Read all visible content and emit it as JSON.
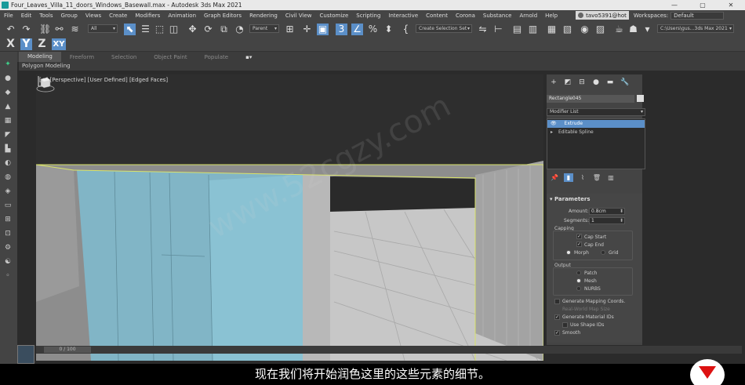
{
  "window": {
    "title": "Four_Leaves_Villa_11_doors_Windows_Basewall.max - Autodesk 3ds Max 2021",
    "min_glyph": "—",
    "max_glyph": "▢",
    "close_glyph": "✕"
  },
  "menubar": {
    "items": [
      "File",
      "Edit",
      "Tools",
      "Group",
      "Views",
      "Create",
      "Modifiers",
      "Animation",
      "Graph Editors",
      "Rendering",
      "Civil View",
      "Customize",
      "Scripting",
      "Interactive",
      "Content",
      "Corona",
      "Substance",
      "Arnold",
      "Help"
    ],
    "user": "tavo5391@hot",
    "workspaces_label": "Workspaces:",
    "workspace": "Default"
  },
  "toolbar": {
    "selection_filter": "All",
    "ref_coord": "Parent",
    "named_selection": "Create Selection Set",
    "path": "C:\\Users\\gus...3ds Max 2021",
    "axis_x": "X",
    "axis_y": "Y",
    "axis_z": "Z",
    "axis_xy": "XY"
  },
  "ribbon": {
    "tabs": [
      "Modeling",
      "Freeform",
      "Selection",
      "Object Paint",
      "Populate"
    ],
    "active_tab": "Modeling",
    "subpanel": "Polygon Modeling"
  },
  "viewport": {
    "label": "[+] [Perspective] [User Defined] [Edged Faces]",
    "selection_color": "#d9e36a",
    "glass_color": "#7fbcd0"
  },
  "command_panel": {
    "object_name": "Rectangle045",
    "modifier_list": "Modifier List",
    "stack": [
      "Extrude",
      "Editable Spline"
    ],
    "selected_stack_item": "Extrude",
    "parameters": {
      "title": "Parameters",
      "amount_label": "Amount:",
      "amount": "0.8cm",
      "segments_label": "Segments:",
      "segments": "1",
      "capping_label": "Capping",
      "cap_start": "Cap Start",
      "cap_end": "Cap End",
      "morph": "Morph",
      "grid": "Grid",
      "output_label": "Output",
      "patch": "Patch",
      "mesh": "Mesh",
      "nurbs": "NURBS",
      "gen_mapping": "Generate Mapping Coords.",
      "real_world": "Real-World Map Size",
      "gen_material": "Generate Material IDs",
      "use_shape": "Use Shape IDs",
      "smooth": "Smooth"
    }
  },
  "timeline": {
    "frame": "0 / 100"
  },
  "subtitle": "现在我们将开始润色这里的这些元素的细节。",
  "watermark": "www.52cgzy.com"
}
